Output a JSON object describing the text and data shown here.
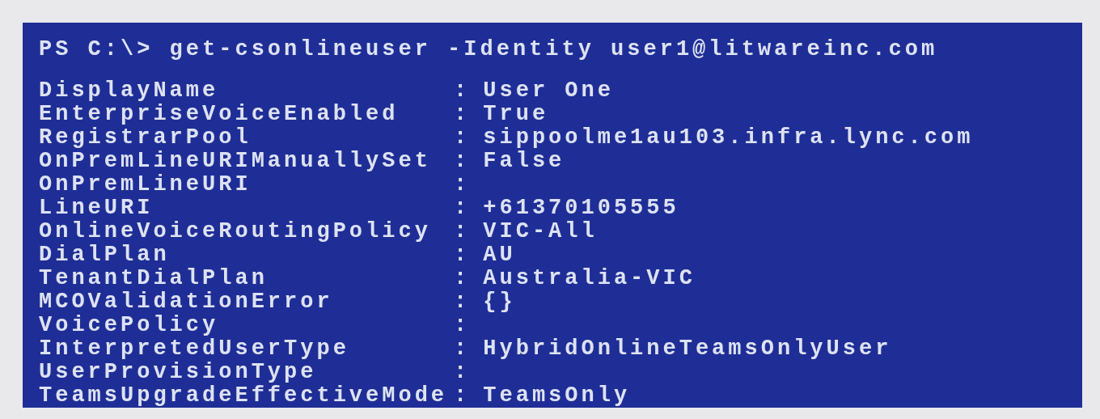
{
  "console": {
    "command": "PS C:\\> get-csonlineuser -Identity user1@litwareinc.com",
    "properties": [
      {
        "name": "DisplayName",
        "separator": ":",
        "value": "User One"
      },
      {
        "name": "EnterpriseVoiceEnabled",
        "separator": ":",
        "value": "True"
      },
      {
        "name": "RegistrarPool",
        "separator": ":",
        "value": "sippoolme1au103.infra.lync.com"
      },
      {
        "name": "OnPremLineURIManuallySet",
        "separator": ":",
        "value": "False"
      },
      {
        "name": "OnPremLineURI",
        "separator": ":"
      },
      {
        "name": "LineURI",
        "separator": ":",
        "value": "+61370105555"
      },
      {
        "name": "OnlineVoiceRoutingPolicy",
        "separator": ":",
        "value": "VIC-All"
      },
      {
        "name": "DialPlan",
        "separator": ":",
        "value": "AU"
      },
      {
        "name": "TenantDialPlan",
        "separator": ":",
        "value": "Australia-VIC"
      },
      {
        "name": "MCOValidationError",
        "separator": ":",
        "value": "{}"
      },
      {
        "name": "VoicePolicy",
        "separator": ":"
      },
      {
        "name": "InterpretedUserType",
        "separator": ":",
        "value": "HybridOnlineTeamsOnlyUser"
      },
      {
        "name": "UserProvisionType",
        "separator": ":"
      },
      {
        "name": "TeamsUpgradeEffectiveMode",
        "separator": ":",
        "value": "TeamsOnly"
      }
    ]
  }
}
